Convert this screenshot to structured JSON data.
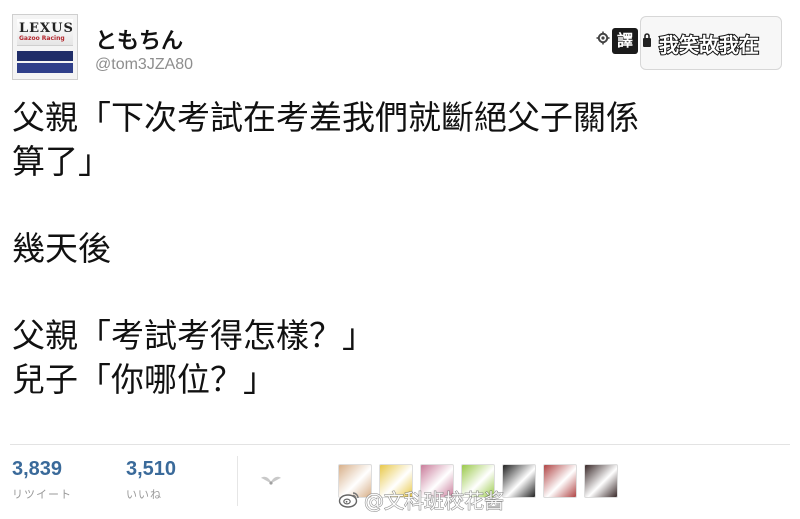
{
  "user": {
    "display_name": "ともちん",
    "handle": "@tom3JZA80",
    "avatar_logo_text": "LEXUS",
    "avatar_sub_text": "Gazoo Racing"
  },
  "toolbar": {
    "translate_label": "譯",
    "follow_label": "我笑故我在"
  },
  "tweet": {
    "lines": [
      "父親「下次考試在考差我們就斷絕父子關係",
      "算了」",
      "",
      "幾天後",
      "",
      "父親「考試考得怎樣？」",
      "兒子「你哪位？」"
    ]
  },
  "stats": {
    "retweets": {
      "value": "3,839",
      "label": "リツイート"
    },
    "likes": {
      "value": "3,510",
      "label": "いいね"
    }
  },
  "likers": {
    "colors": [
      "#d8b08a",
      "#e8c84a",
      "#c97c9a",
      "#9ac94a",
      "#222222",
      "#b04545",
      "#3a2a2a"
    ]
  },
  "watermark": {
    "text": "@文科班校花酱"
  },
  "icons": {
    "gear": "gear-icon",
    "lock": "lock-icon",
    "weibo": "weibo-icon",
    "wings": "wings-icon"
  }
}
